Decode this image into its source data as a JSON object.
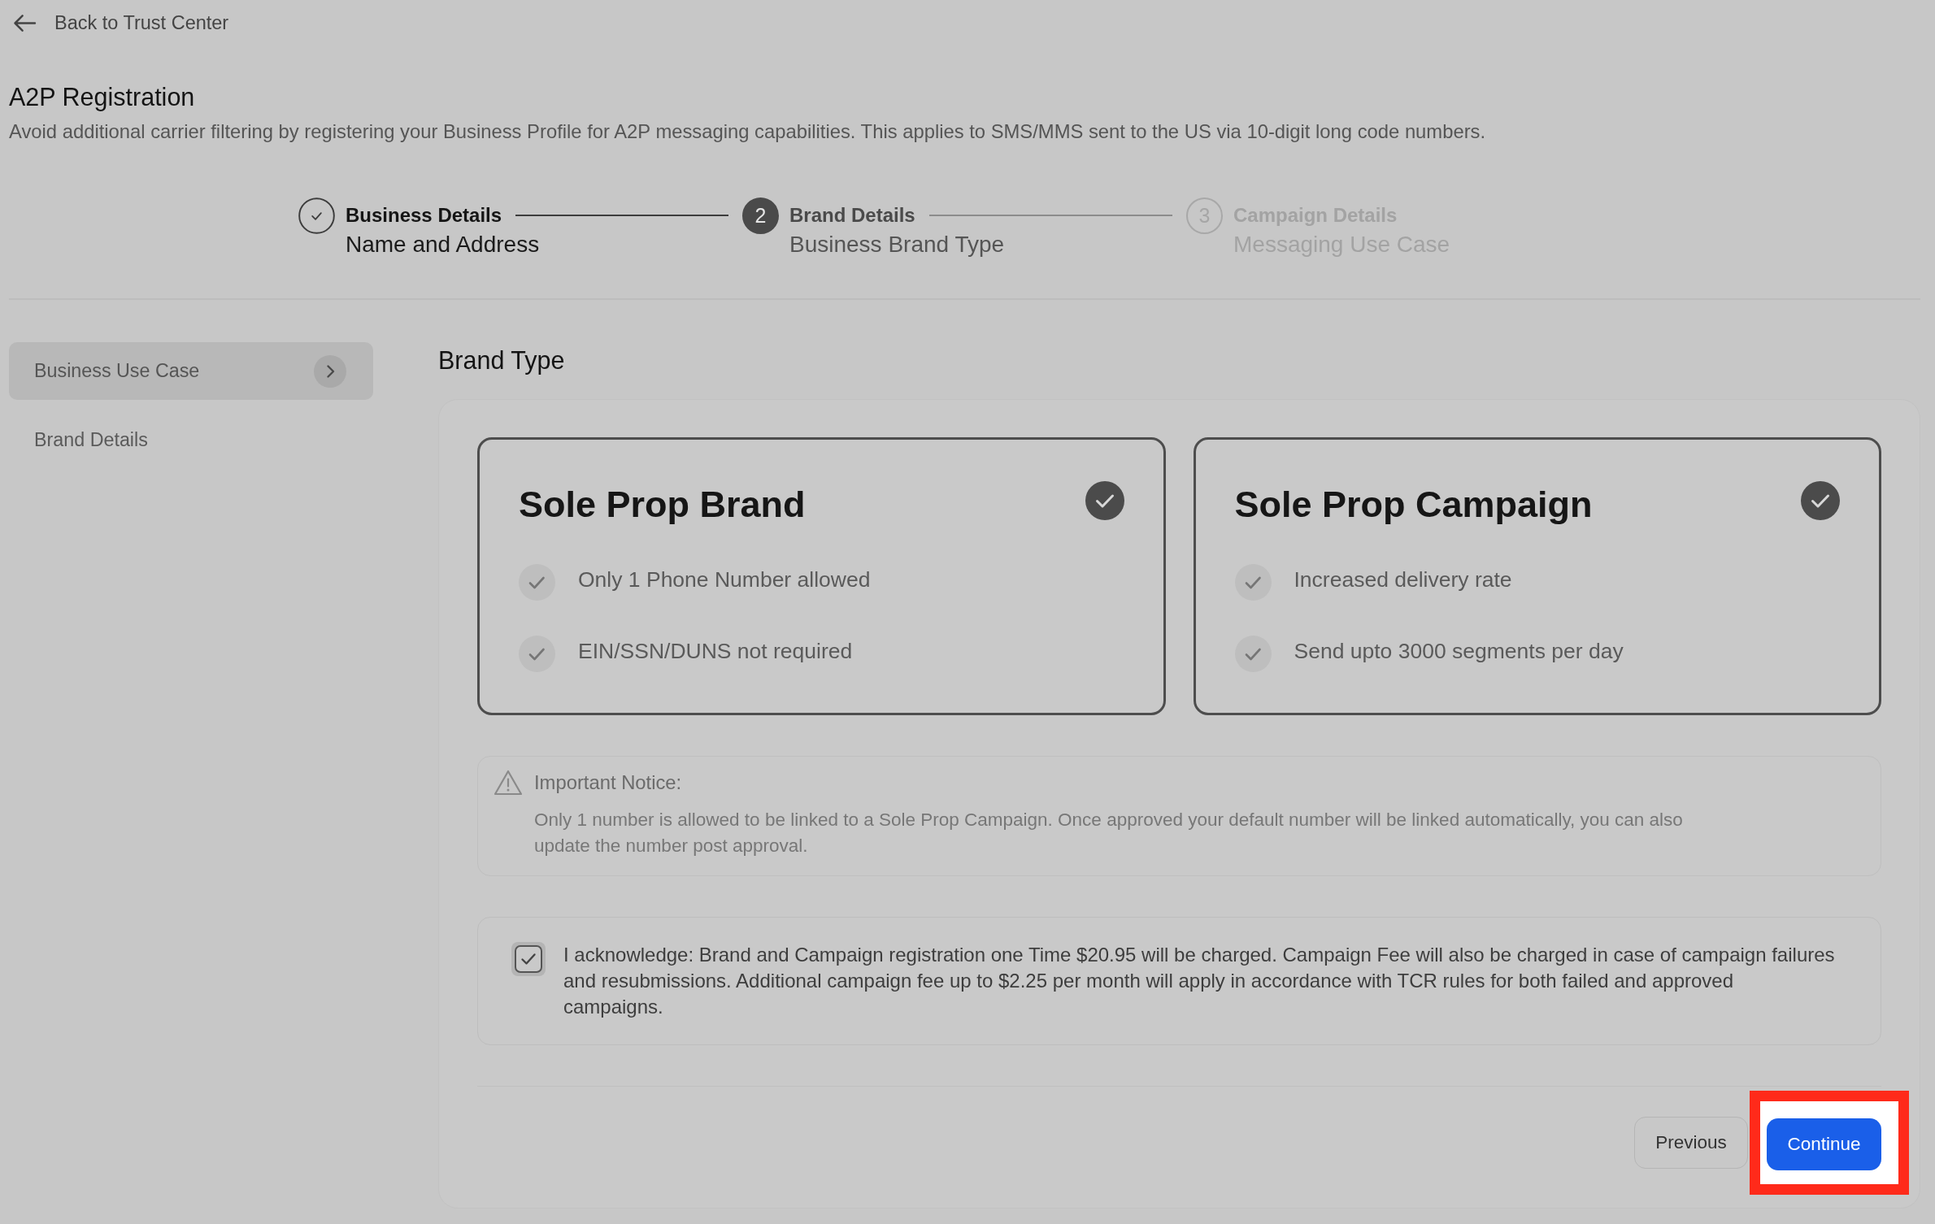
{
  "back_link": {
    "label": "Back to Trust Center"
  },
  "header": {
    "title": "A2P Registration",
    "description": "Avoid additional carrier filtering by registering your Business Profile for A2P messaging capabilities. This applies to SMS/MMS sent to the US via 10-digit long code numbers."
  },
  "stepper": [
    {
      "completed": true,
      "selected": false,
      "title": "Business Details",
      "subtitle": "Name and Address"
    },
    {
      "completed": false,
      "selected": true,
      "number": "2",
      "title": "Brand Details",
      "subtitle": "Business Brand Type"
    },
    {
      "completed": false,
      "selected": false,
      "number": "3",
      "title": "Campaign Details",
      "subtitle": "Messaging Use Case"
    }
  ],
  "sidebar": {
    "items": [
      {
        "label": "Business Use Case",
        "selected": true
      },
      {
        "label": "Brand Details",
        "selected": false
      }
    ]
  },
  "main": {
    "title": "Brand Type",
    "options": [
      {
        "title": "Sole Prop Brand",
        "checked": true,
        "features": [
          "Only 1 Phone Number allowed",
          "EIN/SSN/DUNS not required"
        ]
      },
      {
        "title": "Sole Prop Campaign",
        "checked": true,
        "features": [
          "Increased delivery rate",
          "Send upto 3000 segments per day"
        ]
      }
    ],
    "notice": {
      "title": "Important Notice:",
      "text": "Only 1 number is allowed to be linked to a Sole Prop Campaign. Once approved your default number will be linked automatically, you can also update the number post approval."
    },
    "acknowledgement": {
      "checked": true,
      "text": "I acknowledge: Brand and Campaign registration one Time $20.95 will be charged. Campaign Fee will also be charged in case of campaign failures and resubmissions. Additional campaign fee up to $2.25 per month will apply in accordance with TCR rules for both failed and approved campaigns."
    },
    "buttons": [
      {
        "label": "Previous",
        "kind": "secondary",
        "highlighted": false
      },
      {
        "label": "Continue",
        "kind": "primary",
        "highlighted": true
      }
    ]
  }
}
